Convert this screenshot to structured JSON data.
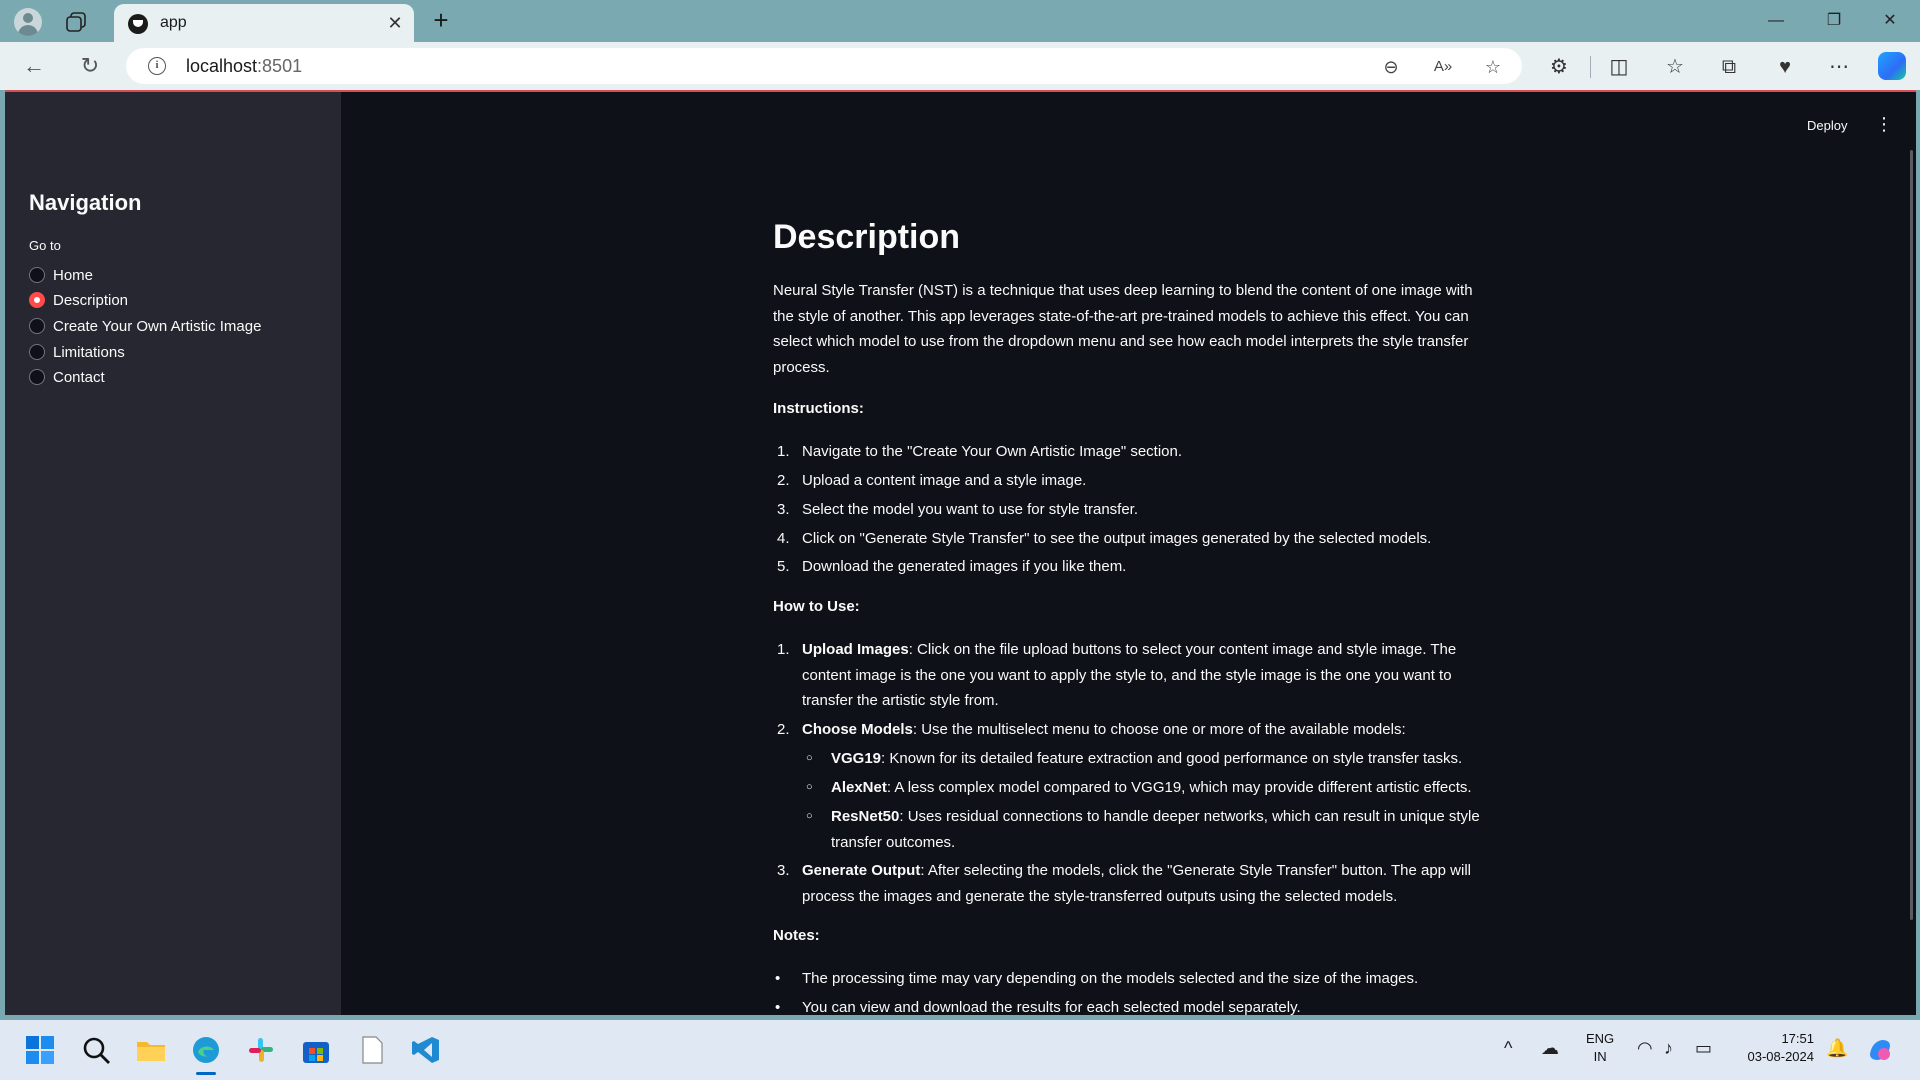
{
  "browser": {
    "tab_title": "app",
    "url_host": "localhost",
    "url_port": ":8501"
  },
  "app": {
    "deploy_label": "Deploy",
    "sidebar": {
      "title": "Navigation",
      "radio_label": "Go to",
      "options": [
        {
          "label": "Home",
          "selected": false
        },
        {
          "label": "Description",
          "selected": true
        },
        {
          "label": "Create Your Own Artistic Image",
          "selected": false
        },
        {
          "label": "Limitations",
          "selected": false
        },
        {
          "label": "Contact",
          "selected": false
        }
      ]
    },
    "main": {
      "title": "Description",
      "intro": "Neural Style Transfer (NST) is a technique that uses deep learning to blend the content of one image with the style of another. This app leverages state-of-the-art pre-trained models to achieve this effect. You can select which model to use from the dropdown menu and see how each model interprets the style transfer process.",
      "instructions_heading": "Instructions:",
      "instructions": [
        "Navigate to the \"Create Your Own Artistic Image\" section.",
        "Upload a content image and a style image.",
        "Select the model you want to use for style transfer.",
        "Click on \"Generate Style Transfer\" to see the output images generated by the selected models.",
        "Download the generated images if you like them."
      ],
      "howto_heading": "How to Use:",
      "howto": [
        {
          "bold": "Upload Images",
          "text": ": Click on the file upload buttons to select your content image and style image. The content image is the one you want to apply the style to, and the style image is the one you want to transfer the artistic style from."
        },
        {
          "bold": "Choose Models",
          "text": ": Use the multiselect menu to choose one or more of the available models:"
        },
        {
          "bold": "Generate Output",
          "text": ": After selecting the models, click the \"Generate Style Transfer\" button. The app will process the images and generate the style-transferred outputs using the selected models."
        }
      ],
      "models": [
        {
          "bold": "VGG19",
          "text": ": Known for its detailed feature extraction and good performance on style transfer tasks."
        },
        {
          "bold": "AlexNet",
          "text": ": A less complex model compared to VGG19, which may provide different artistic effects."
        },
        {
          "bold": "ResNet50",
          "text": ": Uses residual connections to handle deeper networks, which can result in unique style transfer outcomes."
        }
      ],
      "notes_heading": "Notes:",
      "notes": [
        "The processing time may vary depending on the models selected and the size of the images.",
        "You can view and download the results for each selected model separately."
      ]
    }
  },
  "taskbar": {
    "lang_line1": "ENG",
    "lang_line2": "IN",
    "time": "17:51",
    "date": "03-08-2024"
  },
  "colors": {
    "accent": "#ff4b4b",
    "app_bg": "#0e1117",
    "sidebar_bg": "#262730",
    "chrome": "#7aa9b1"
  }
}
